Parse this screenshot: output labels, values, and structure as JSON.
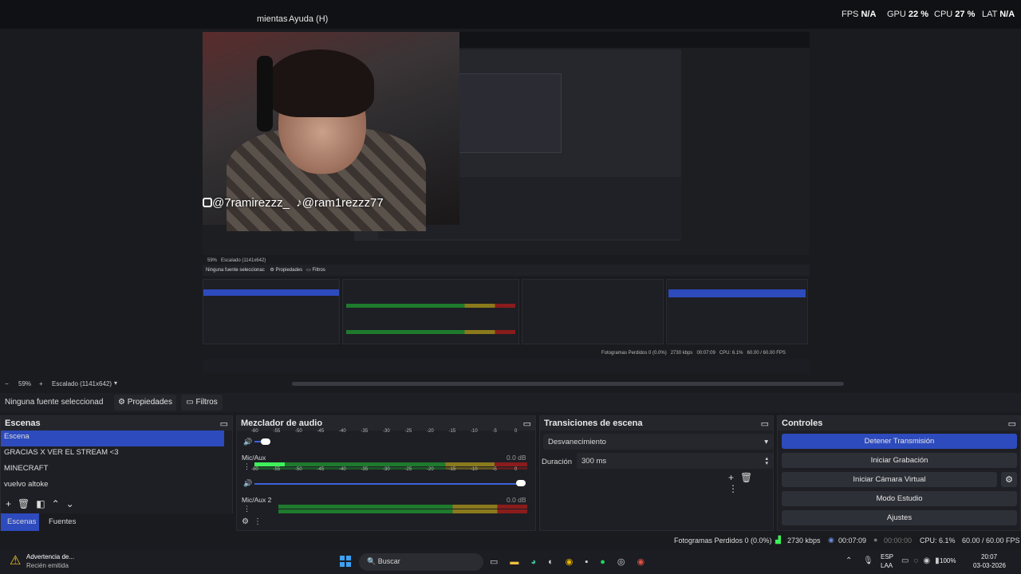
{
  "menu": {
    "tools": "mientas",
    "help": "Ayuda (H)"
  },
  "stats": {
    "fps_label": "FPS",
    "fps": "N/A",
    "gpu_label": "GPU",
    "gpu": "22 %",
    "cpu_label": "CPU",
    "cpu": "27 %",
    "lat_label": "LAT",
    "lat": "N/A"
  },
  "overlay": {
    "instagram": "@7ramirezzz_",
    "tiktok": "@ram1rezzz77"
  },
  "zoom": {
    "minus": "−",
    "percent": "59%",
    "plus": "+",
    "scale": "Escalado (1141x642)"
  },
  "source_bar": {
    "none": "Ninguna fuente seleccionad",
    "props": "Propiedades",
    "filters": "Filtros"
  },
  "scenes": {
    "title": "Escenas",
    "items": [
      "Escena",
      "GRACIAS X VER EL STREAM <3",
      "MINECRAFT",
      "vuelvo altoke"
    ],
    "tab_scenes": "Escenas",
    "tab_sources": "Fuentes"
  },
  "mixer": {
    "title": "Mezclador de audio",
    "ticks": [
      "-60",
      "-55",
      "-50",
      "-45",
      "-40",
      "-35",
      "-30",
      "-25",
      "-20",
      "-15",
      "-10",
      "-5",
      "0"
    ],
    "ch1_name": "Mic/Aux",
    "ch1_db": "0.0 dB",
    "ch2_name": "Mic/Aux 2",
    "ch2_db": "0.0 dB"
  },
  "transitions": {
    "title": "Transiciones de escena",
    "selected": "Desvanecimiento",
    "duration_label": "Duración",
    "duration": "300 ms"
  },
  "controls": {
    "title": "Controles",
    "stop_stream": "Detener Transmisión",
    "start_rec": "Iniciar Grabación",
    "virtual_cam": "Iniciar Cámara Virtual",
    "studio": "Modo Estudio",
    "settings": "Ajustes"
  },
  "status": {
    "dropped": "Fotogramas Perdidos 0 (0.0%)",
    "kbps": "2730 kbps",
    "stream_time": "00:07:09",
    "rec_time": "00:00:00",
    "cpu": "CPU: 6.1%",
    "fps": "60.00 / 60.00 FPS"
  },
  "taskbar": {
    "notif_title": "Advertencia de...",
    "notif_sub": "Recién emitida",
    "search": "Buscar",
    "lang1": "ESP",
    "lang2": "LAA",
    "battery": "100%",
    "time": "20:07",
    "date": "03-03-2026"
  },
  "inner": {
    "none": "Ninguna fuente seleccionac",
    "props": "Propiedades",
    "filters": "Filtros",
    "scale": "Escalado (1141x642)",
    "zoom": "59%",
    "status": "Fotogramas Perdidos 0 (0.0%)",
    "kbps": "2730 kbps",
    "time": "00:07:09",
    "cpu": "CPU: 6.1%",
    "fps": "60.00 / 60.00 FPS"
  },
  "colors": {
    "accent": "#2d4bbd",
    "bg": "#1a1b1f",
    "meter_green": "#1e7a2d",
    "meter_yellow": "#8a7a1c",
    "meter_red": "#8a1c1c"
  }
}
